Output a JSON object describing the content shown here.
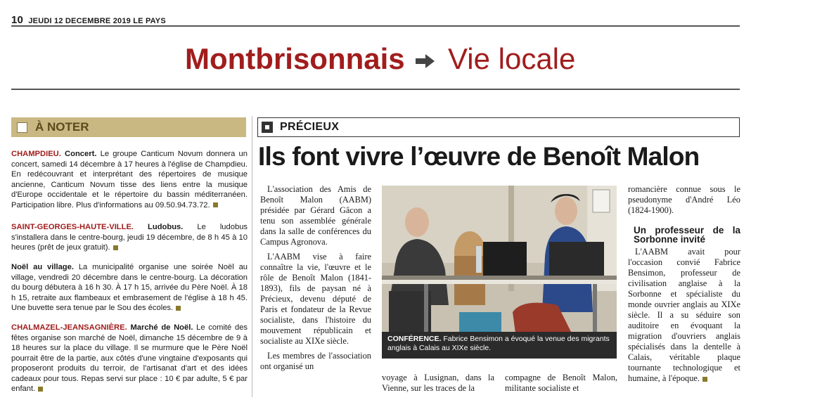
{
  "masthead": {
    "page_number": "10",
    "date_line": "JEUDI 12 DECEMBRE 2019 LE PAYS"
  },
  "section": {
    "main": "Montbrisonnais",
    "sub": "Vie locale",
    "arrow_icon": "right-arrow-icon",
    "color": "#a11d1d"
  },
  "a_noter": {
    "label": "À NOTER",
    "bar_color": "#c9b882",
    "items": [
      {
        "place": "CHAMPDIEU.",
        "title": "Concert.",
        "text": "Le groupe Canticum Novum donnera un concert, samedi 14 décembre à 17 heures à l'église de Champdieu. En redécouvrant et interprétant des répertoires de musique ancienne, Canticum Novum tisse des liens entre la musique d'Europe occidentale et le répertoire du bassin méditerranéen. Participation libre. Plus d'informations au 09.50.94.73.72."
      },
      {
        "place": "SAINT-GEORGES-HAUTE-VILLE.",
        "title": "Ludobus.",
        "text": "Le ludobus s'installera dans le centre-bourg, jeudi 19 décembre, de 8 h 45 à 10 heures (prêt de jeux gratuit)."
      },
      {
        "place": "",
        "title": "Noël au village.",
        "text": "La municipalité organise une soirée Noël au village, vendredi 20 décembre dans le centre-bourg. La décoration du bourg débutera à 16 h 30. À 17 h 15, arrivée du Père Noël. À 18 h 15, retraite aux flambeaux et embrasement de l'église à 18 h 45. Une buvette sera tenue par le Sou des écoles."
      },
      {
        "place": "CHALMAZEL-JEANSAGNIÈRE.",
        "title": "Marché de Noël.",
        "text": "Le comité des fêtes organise son marché de Noël, dimanche 15 décembre de 9 à 18 heures sur la place du village. Il se murmure que le Père Noël pourrait être de la partie, aux côtés d'une vingtaine d'exposants qui proposeront produits du terroir, de l'artisanat d'art et des idées cadeaux pour tous. Repas servi sur place : 10 € par adulte, 5 € par enfant."
      }
    ]
  },
  "story": {
    "rubric": "PRÉCIEUX",
    "title": "Ils font vivre l’œuvre de Benoît Malon",
    "col1_paragraphs": [
      "L'association des Amis de Benoît Malon (AABM) présidée par Gérard Gâcon a tenu son assemblée générale dans la salle de conférences du Campus Agronova.",
      "L'AABM vise à faire connaître la vie, l'œuvre et le rôle de Benoît Malon (1841-1893), fils de paysan né à Précieux, devenu député de Paris et fondateur de la Revue socialiste, dans l'histoire du mouvement républicain et socialiste au XIXe siècle.",
      "Les membres de l'association ont organisé un"
    ],
    "photo_caption_kick": "CONFÉRENCE.",
    "photo_caption_text": "Fabrice Bensimon a évoqué la venue des migrants anglais à Calais au XIXe siècle.",
    "col2_bottom": "voyage à Lusignan, dans la Vienne, sur les traces de la",
    "col3_bottom": "compagne de Benoît Malon, militante socialiste et",
    "col4_top": "romancière connue sous le pseudonyme d'André Léo (1824-1900).",
    "subhead": "Un professeur de la Sorbonne invité",
    "col4_body": "L'AABM avait pour l'occasion convié Fabrice Bensimon, professeur de civilisation anglaise à la Sorbonne et spécialiste du monde ouvrier anglais au XIXe siècle. Il a su séduire son auditoire en évoquant la migration d'ouvriers anglais spécialisés dans la dentelle à Calais, véritable plaque tournante technologique et humaine, à l'époque."
  }
}
